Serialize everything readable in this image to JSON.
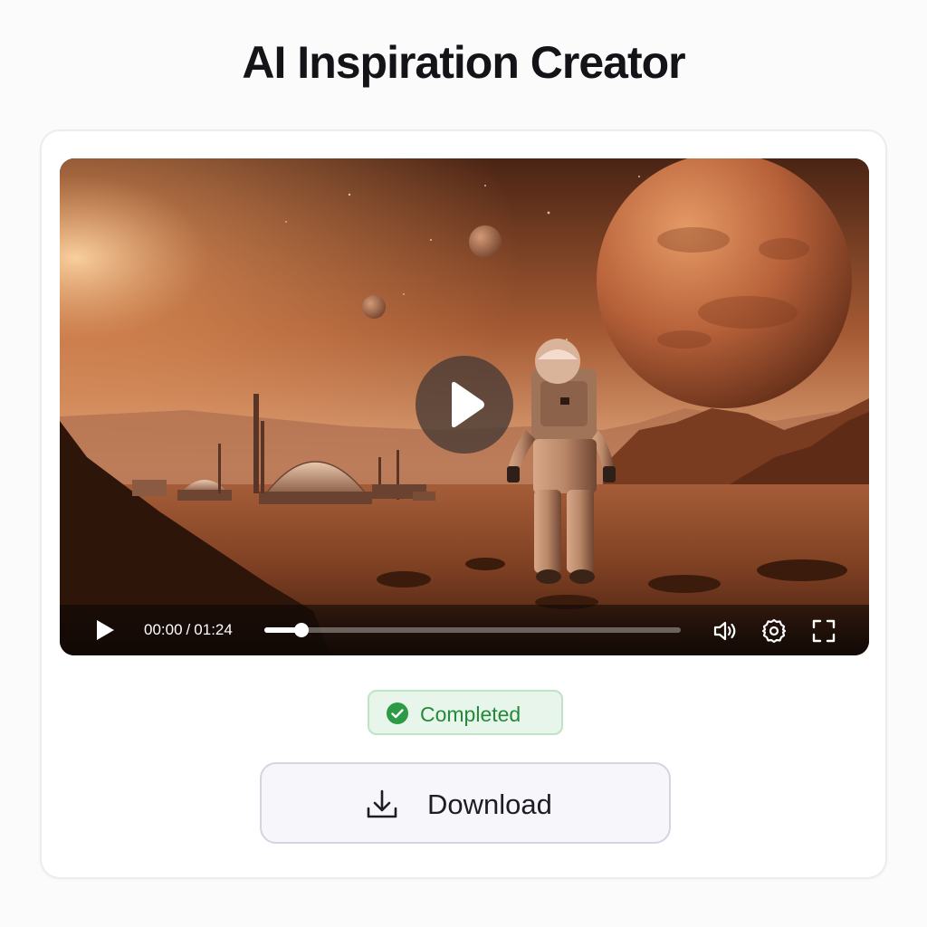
{
  "page": {
    "title": "AI Inspiration Creator"
  },
  "player": {
    "current_time": "00:00",
    "separator": "/",
    "duration": "01:24",
    "progress": 0.09,
    "icons": {
      "overlay": "play-icon",
      "control_play": "play-icon",
      "volume": "volume-icon",
      "settings": "gear-icon",
      "fullscreen": "fullscreen-icon"
    }
  },
  "status": {
    "label": "Completed",
    "icon": "check-circle-icon",
    "color": "#238a3a"
  },
  "download": {
    "label": "Download",
    "icon": "download-icon"
  }
}
